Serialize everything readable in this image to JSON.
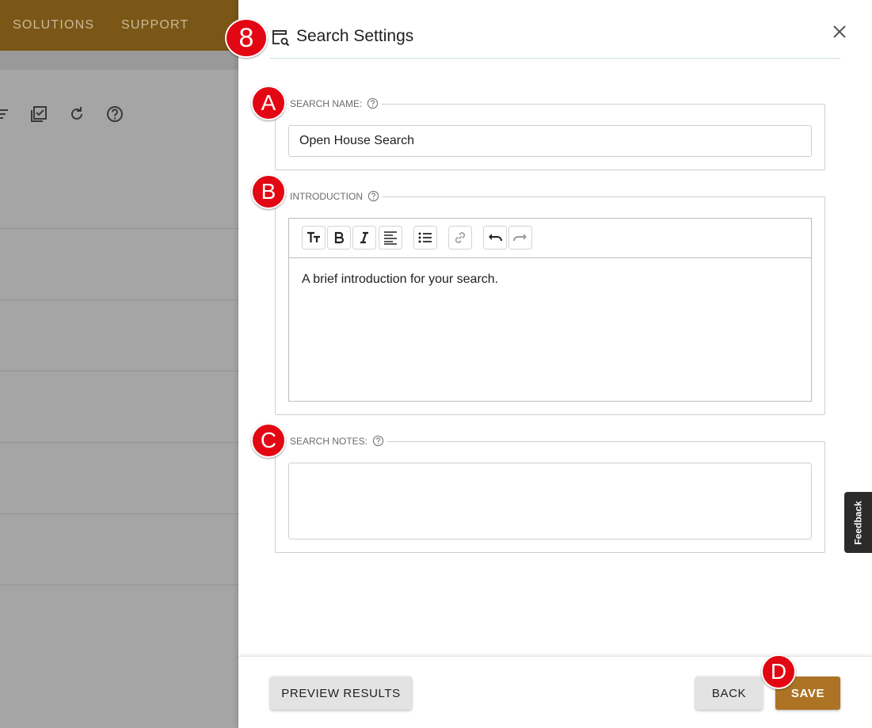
{
  "background_app": {
    "nav": [
      "SOLUTIONS",
      "SUPPORT"
    ],
    "toolbar_icons": [
      "filter-icon",
      "checkbox-list-icon",
      "refresh-icon",
      "help-icon"
    ]
  },
  "drawer": {
    "title": "Search Settings",
    "title_icon": "search-settings-icon",
    "close_icon": "close-icon"
  },
  "form": {
    "search_name": {
      "label": "SEARCH NAME:",
      "value": "Open House Search"
    },
    "introduction": {
      "label": "INTRODUCTION",
      "toolbar": [
        "text-size-icon",
        "bold-icon",
        "italic-icon",
        "align-left-icon",
        "bullet-list-icon",
        "link-icon",
        "undo-icon",
        "redo-icon"
      ],
      "placeholder": "A brief introduction for your search."
    },
    "search_notes": {
      "label": "SEARCH NOTES:",
      "value": ""
    }
  },
  "footer": {
    "preview_label": "PREVIEW RESULTS",
    "back_label": "BACK",
    "save_label": "SAVE"
  },
  "markers": {
    "step": "8",
    "a": "A",
    "b": "B",
    "c": "C",
    "d": "D"
  },
  "feedback_label": "Feedback",
  "colors": {
    "brand_gold": "#ad7325",
    "topbar": "#7a5716",
    "marker_red": "#e30613"
  }
}
